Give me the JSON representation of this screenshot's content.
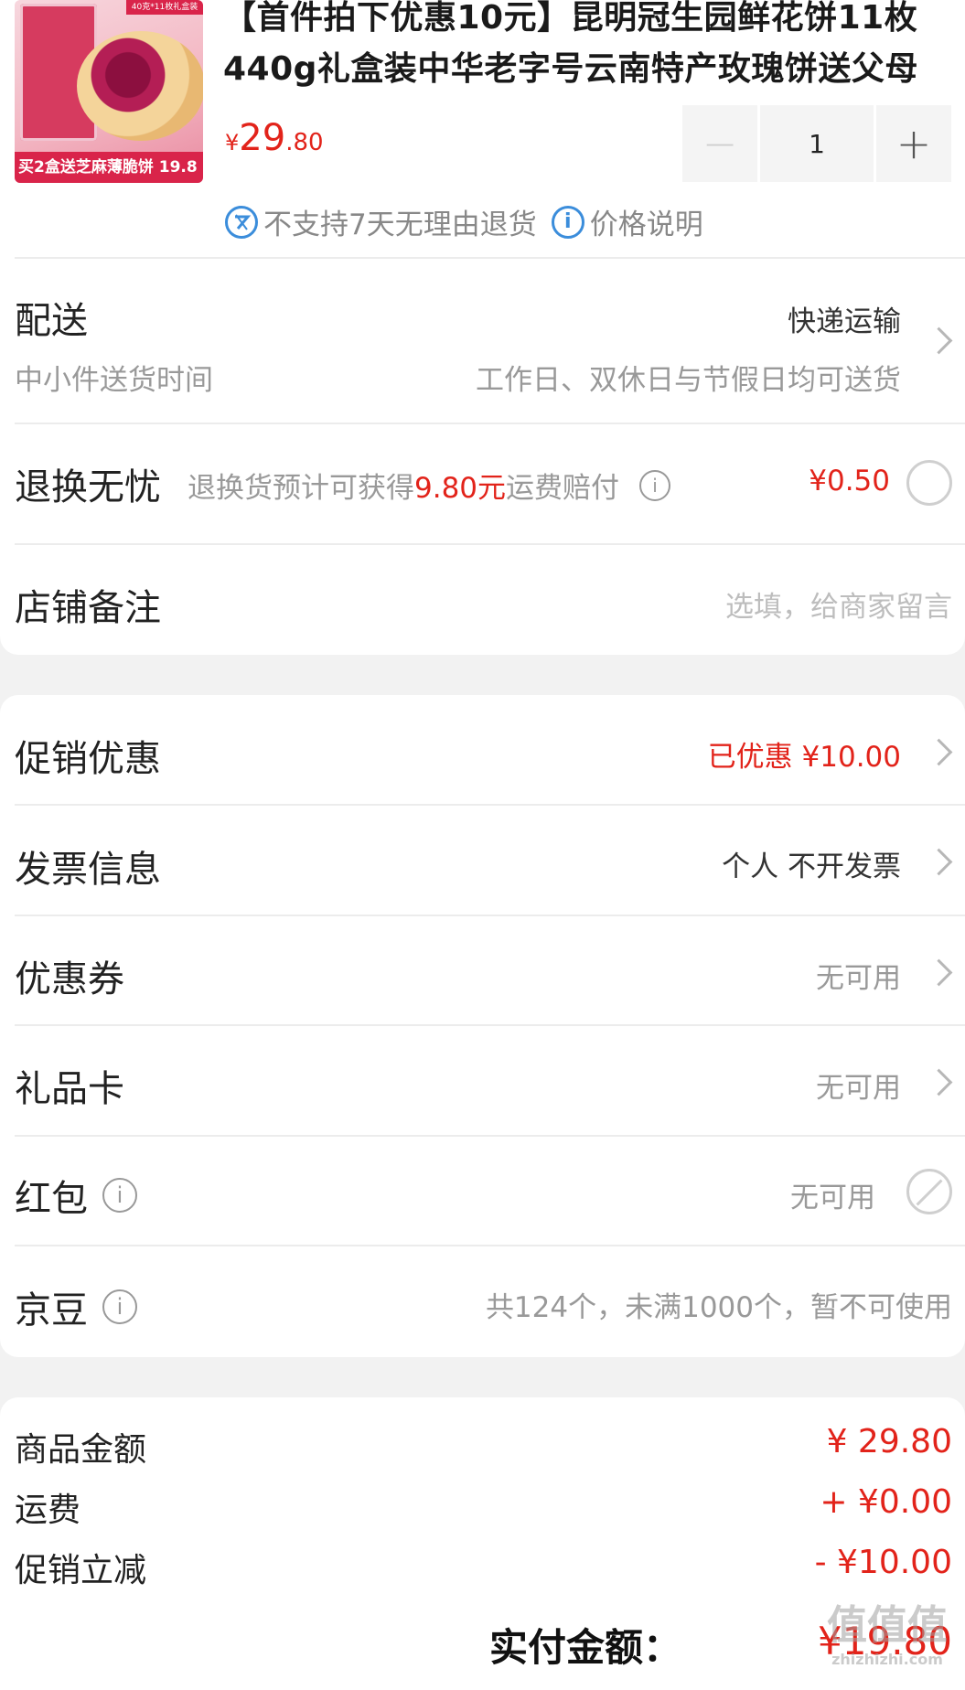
{
  "product": {
    "image_ribbon": "买2盒送芝麻薄脆饼",
    "image_price": "19.8",
    "image_corner": "40克*11枚礼盒装",
    "title": "【首件拍下优惠10元】昆明冠生园鲜花饼11枚440g礼盒装中华老字号云南特产玫瑰饼送父母",
    "price_currency": "¥",
    "price_int": "29",
    "price_dec": ".80",
    "quantity": "1",
    "minus": "−",
    "plus": "+",
    "return_policy": "不支持7天无理由退货",
    "price_explain": "价格说明"
  },
  "delivery": {
    "label": "配送",
    "method": "快递运输",
    "sub_label": "中小件送货时间",
    "sub_value": "工作日、双休日与节假日均可送货"
  },
  "return_insurance": {
    "label": "退换无忧",
    "desc_pre": "退换货预计可获得",
    "desc_amount": "9.80元",
    "desc_post": "运费赔付",
    "price": "¥0.50"
  },
  "shop_note": {
    "label": "店铺备注",
    "placeholder": "选填，给商家留言"
  },
  "promotion": {
    "label": "促销优惠",
    "value": "已优惠 ¥10.00"
  },
  "invoice": {
    "label": "发票信息",
    "value": "个人 不开发票"
  },
  "coupon": {
    "label": "优惠券",
    "value": "无可用"
  },
  "giftcard": {
    "label": "礼品卡",
    "value": "无可用"
  },
  "redpacket": {
    "label": "红包",
    "value": "无可用"
  },
  "jingdou": {
    "label": "京豆",
    "value": "共124个，未满1000个，暂不可使用"
  },
  "summary": {
    "goods_label": "商品金额",
    "goods_value": "¥ 29.80",
    "shipping_label": "运费",
    "shipping_value": "+ ¥0.00",
    "discount_label": "促销立减",
    "discount_value": "- ¥10.00",
    "total_label": "实付金额：",
    "total_value": "¥19.80"
  },
  "watermark": {
    "line1": "值值值",
    "line2": "zhizhizhi.com"
  },
  "colors": {
    "accent": "#e2231a",
    "link": "#3b8ddb"
  },
  "icons": [
    "no-return-icon",
    "info-icon",
    "chevron-right-icon",
    "radio-icon",
    "disabled-icon"
  ]
}
